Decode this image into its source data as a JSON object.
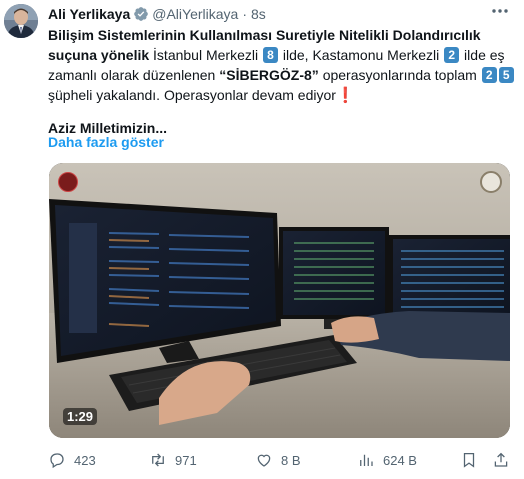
{
  "post": {
    "author_name": "Ali Yerlikaya",
    "handle": "@AliYerlikaya",
    "separator": "·",
    "time": "8s",
    "text": {
      "l1": "Bilişim Sistemlerinin Kullanılması Suretiyle Nitelikli Dolandırıcılık",
      "l2_bold": "suçuna yönelik",
      "l2_a": " İstanbul Merkezli ",
      "num_8": "8",
      "l2_b": " ilde, Kastamonu Merkezli ",
      "num_2": "2",
      "l2_c": " ilde eş",
      "l3_a": "zamanlı olarak düzenlenen ",
      "op_name": "“SİBERGÖZ-8”",
      "l3_b": " operasyonlarında toplam ",
      "num_25a": "2",
      "num_25b": "5",
      "l4": "şüpheli  yakalandı. Operasyonlar devam ediyor",
      "excl": "❗"
    },
    "greeting": "Aziz Milletimizin...",
    "show_more": "Daha fazla göster",
    "video": {
      "duration": "1:29"
    },
    "actions": {
      "replies": "423",
      "reposts": "971",
      "likes": "8 B",
      "views": "624 B"
    },
    "icons": [
      "verified-icon",
      "more-icon",
      "reply-icon",
      "repost-icon",
      "like-icon",
      "views-icon",
      "bookmark-icon",
      "share-icon"
    ],
    "colors": {
      "accent": "#1d9bf0",
      "muted": "#536471",
      "keycap": "#3b88c3",
      "exclamation": "#e0312b"
    }
  }
}
